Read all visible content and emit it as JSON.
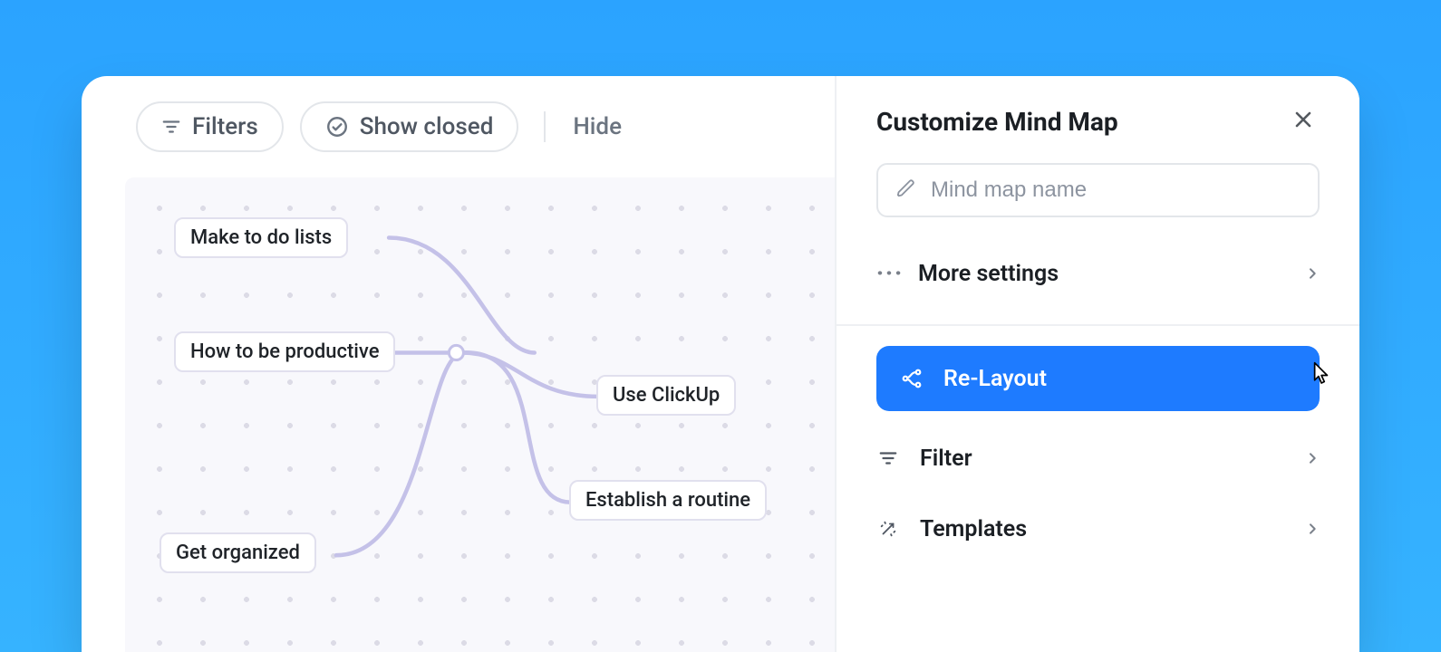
{
  "toolbar": {
    "filters_label": "Filters",
    "show_closed_label": "Show closed",
    "hide_label": "Hide"
  },
  "mindmap": {
    "nodes": {
      "n1": {
        "label": "Make to do lists"
      },
      "n2": {
        "label": "How to be productive"
      },
      "n3": {
        "label": "Use ClickUp"
      },
      "n4": {
        "label": "Establish a routine"
      },
      "n5": {
        "label": "Get organized"
      }
    }
  },
  "panel": {
    "title": "Customize Mind Map",
    "name_placeholder": "Mind map name",
    "name_value": "",
    "more_settings_label": "More settings",
    "actions": {
      "relayout": "Re-Layout",
      "filter": "Filter",
      "templates": "Templates"
    },
    "selected_action": "relayout"
  },
  "icons": {
    "filter": "filter-icon",
    "check_circle": "check-circle-icon",
    "close": "close-icon",
    "pencil": "pencil-icon",
    "dots": "more-dots-icon",
    "chevron_right": "chevron-right-icon",
    "relayout": "relayout-icon",
    "wand": "wand-icon",
    "cursor": "pointer-cursor-icon"
  },
  "colors": {
    "accent": "#1e7bff",
    "edge": "#c4c1e8"
  }
}
